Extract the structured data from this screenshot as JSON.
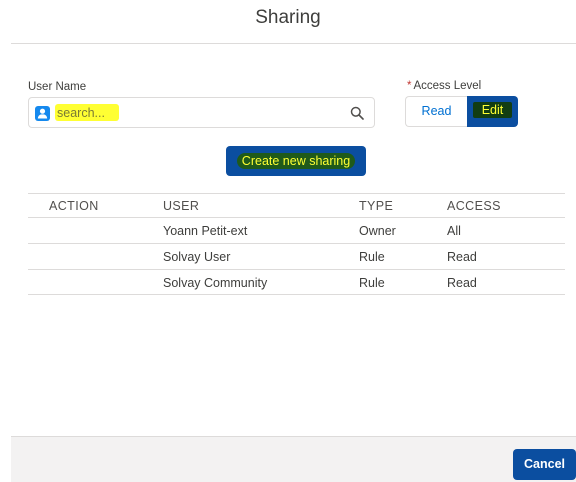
{
  "modal": {
    "title": "Sharing"
  },
  "form": {
    "user_name_label": "User Name",
    "access_level_required": "*",
    "access_level_label": "Access Level",
    "search": {
      "placeholder": "search..."
    },
    "access_options": [
      "Read",
      "Edit"
    ],
    "access_selected": "Edit",
    "create_button_label": "Create new sharing"
  },
  "table": {
    "headers": [
      "ACTION",
      "USER",
      "TYPE",
      "ACCESS"
    ],
    "rows": [
      {
        "action": "",
        "user": "Yoann Petit-ext",
        "type": "Owner",
        "access": "All"
      },
      {
        "action": "",
        "user": "Solvay User",
        "type": "Rule",
        "access": "Read"
      },
      {
        "action": "",
        "user": "Solvay Community",
        "type": "Rule",
        "access": "Read"
      }
    ]
  },
  "footer": {
    "cancel_label": "Cancel"
  },
  "icons": {
    "avatar": "user-icon",
    "search": "search-icon"
  },
  "colors": {
    "brand": "#0b4ea0",
    "highlight": "#ffff33",
    "link": "#0070d2"
  }
}
